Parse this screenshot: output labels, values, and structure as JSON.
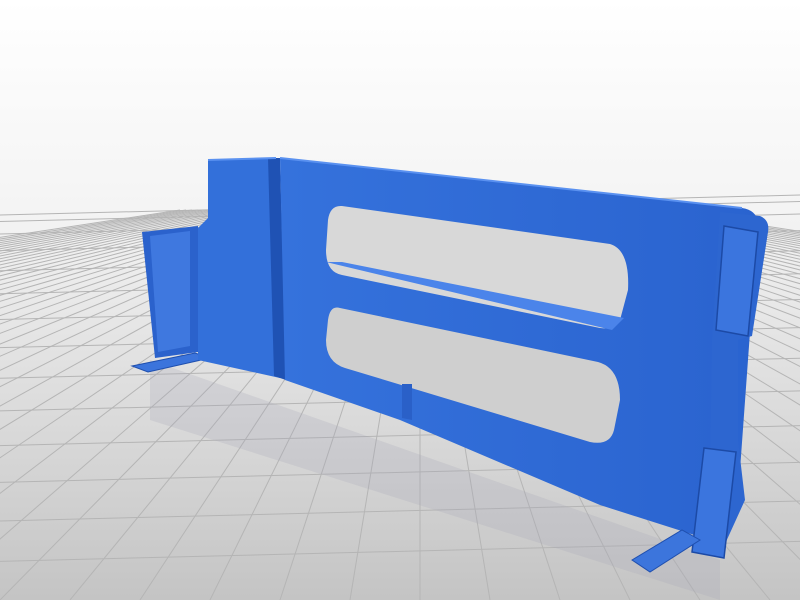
{
  "scene": {
    "subject": "3d-printed-bracket",
    "colors": {
      "background_top": "#ffffff",
      "background_floor": "#c9c9c9",
      "grid_line": "#b3b3b3",
      "part_front": "#2e67d3",
      "part_light": "#4d86ea",
      "part_dark": "#1c4aa6",
      "part_edge": "#163c8c"
    }
  }
}
